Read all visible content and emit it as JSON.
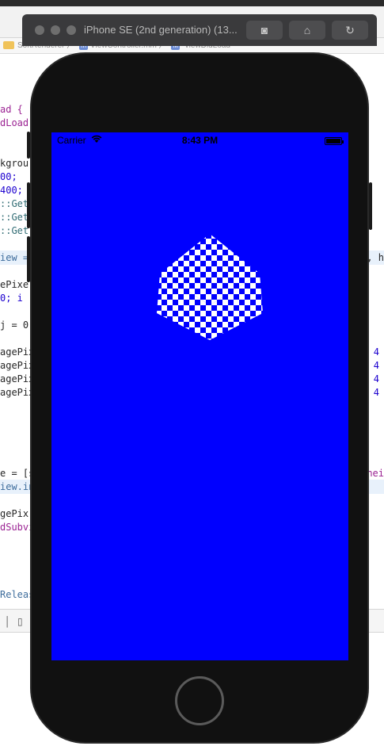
{
  "xcode": {
    "jumpbar": {
      "project": "SoftRenderer",
      "file": "ViewController.mm",
      "method": "-viewDidLoad"
    },
    "code_fragments_left": [
      "ad {",
      "dLoad]",
      "kgrou",
      "00;",
      "400;",
      "::Get",
      "::Get",
      "::Get",
      "iew =",
      "ePixe",
      "0; i",
      "j = 0",
      "agePix",
      "agePix",
      "agePix",
      "agePix",
      "e = [s",
      "iew.in",
      "gePix",
      "dSubvi",
      "Releas"
    ],
    "code_fragments_right": [
      ", h",
      "4",
      "4",
      "4",
      "4",
      "nei"
    ]
  },
  "simulator": {
    "title": "iPhone SE (2nd generation) (13...",
    "buttons": [
      {
        "name": "screenshot-button",
        "icon": "camera-icon",
        "glyph": "◙"
      },
      {
        "name": "home-button",
        "icon": "home-icon",
        "glyph": "⌂"
      },
      {
        "name": "rotate-button",
        "icon": "rotate-icon",
        "glyph": "↻"
      }
    ]
  },
  "device": {
    "status_bar": {
      "carrier": "Carrier",
      "time": "8:43 PM"
    },
    "screen_color": "#0000ff",
    "cube_colors": {
      "light": "#ffffff",
      "dark": "#0000ff"
    }
  }
}
